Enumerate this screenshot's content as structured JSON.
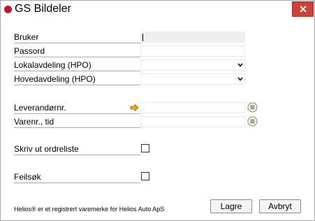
{
  "window": {
    "title": "GS Bildeler"
  },
  "form": {
    "bruker_label": "Bruker",
    "passord_label": "Passord",
    "lokal_label": "Lokalavdeling (HPO)",
    "hoved_label": "Hovedavdeling (HPO)",
    "leverandor_label": "Leverandørnr.",
    "varenr_label": "Varenr., tid",
    "skriv_label": "Skriv ut ordreliste",
    "feilsok_label": "Feilsøk"
  },
  "footer": {
    "trademark": "Helios® er et registrert varemerke for Helios Auto ApS",
    "ok_label": "Lagre",
    "cancel_label": "Avbryt"
  },
  "colors": {
    "title_dot": "#b21a2b",
    "close_button": "#c8433a"
  },
  "icons": [
    "app-dot-icon",
    "close-icon",
    "chevron-down-icon",
    "arrow-right-icon",
    "lookup-icon"
  ]
}
